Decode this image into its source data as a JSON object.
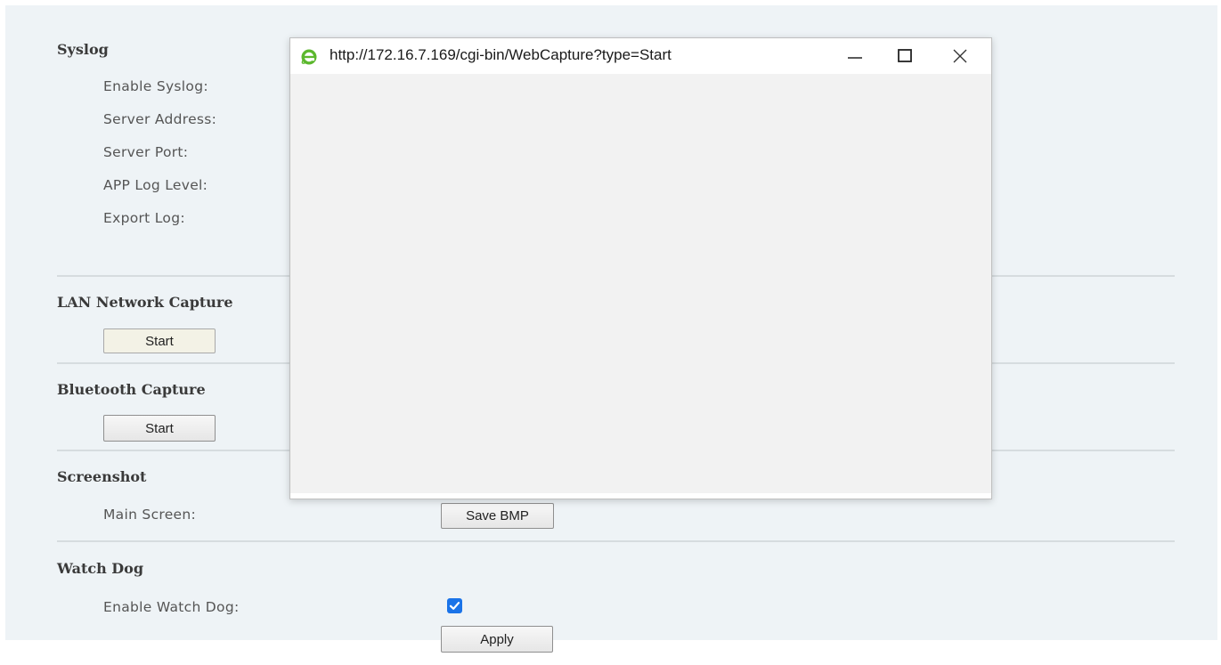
{
  "syslog": {
    "title": "Syslog",
    "labels": [
      "Enable Syslog:",
      "Server Address:",
      "Server Port:",
      "APP Log Level:",
      "Export Log:"
    ]
  },
  "lan_capture": {
    "title": "LAN Network Capture",
    "start_label": "Start"
  },
  "bluetooth_capture": {
    "title": "Bluetooth Capture",
    "start_label": "Start"
  },
  "screenshot": {
    "title": "Screenshot",
    "main_screen_label": "Main Screen:",
    "save_label": "Save BMP"
  },
  "watchdog": {
    "title": "Watch Dog",
    "enable_label": "Enable Watch Dog:",
    "enabled": true,
    "apply_label": "Apply"
  },
  "popup": {
    "url": "http://172.16.7.169/cgi-bin/WebCapture?type=Start",
    "icon": "ie-browser-icon"
  },
  "colors": {
    "panel_bg": "#eef3f6",
    "checkbox": "#1a73e8",
    "ie_icon": "#5cb82e"
  }
}
